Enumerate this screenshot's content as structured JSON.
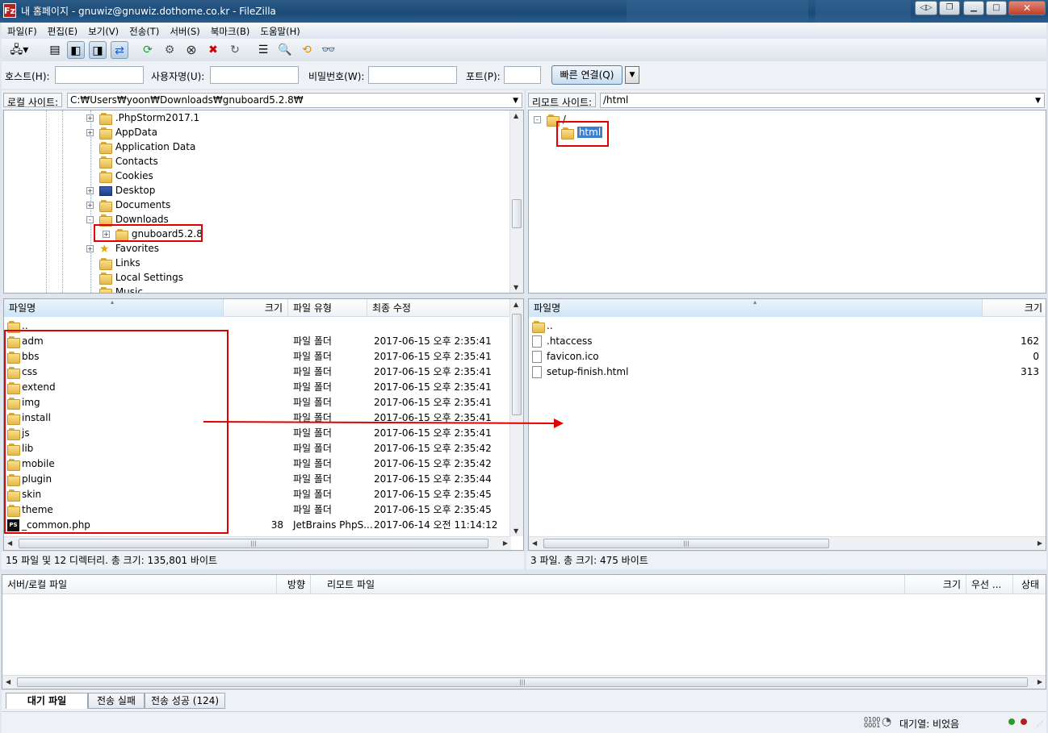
{
  "window": {
    "title": "내 홈페이지 - gnuwiz@gnuwiz.dothome.co.kr - FileZilla",
    "icon": "Fz"
  },
  "menu": [
    "파일(F)",
    "편집(E)",
    "보기(V)",
    "전송(T)",
    "서버(S)",
    "북마크(B)",
    "도움말(H)"
  ],
  "quick": {
    "host_label": "호스트(H):",
    "user_label": "사용자명(U):",
    "pass_label": "비밀번호(W):",
    "port_label": "포트(P):",
    "connect": "빠른 연결(Q)",
    "host": "",
    "user": "",
    "pass": "",
    "port": ""
  },
  "local": {
    "site_label": "로컬 사이트:",
    "path": "C:₩Users₩yoon₩Downloads₩gnuboard5.2.8₩",
    "tree": [
      {
        "name": ".PhpStorm2017.1",
        "type": "folder",
        "exp": "+"
      },
      {
        "name": "AppData",
        "type": "folder",
        "exp": "+"
      },
      {
        "name": "Application Data",
        "type": "folder",
        "exp": ""
      },
      {
        "name": "Contacts",
        "type": "folder",
        "exp": ""
      },
      {
        "name": "Cookies",
        "type": "folder",
        "exp": ""
      },
      {
        "name": "Desktop",
        "type": "desktop",
        "exp": "+"
      },
      {
        "name": "Documents",
        "type": "folder",
        "exp": "+"
      },
      {
        "name": "Downloads",
        "type": "folder",
        "exp": "-"
      },
      {
        "name": "gnuboard5.2.8",
        "type": "folder",
        "exp": "+",
        "child": true
      },
      {
        "name": "Favorites",
        "type": "star",
        "exp": "+"
      },
      {
        "name": "Links",
        "type": "folder",
        "exp": ""
      },
      {
        "name": "Local Settings",
        "type": "folder",
        "exp": ""
      },
      {
        "name": "Music",
        "type": "folder",
        "exp": ""
      }
    ],
    "columns": [
      "파일명",
      "크기",
      "파일 유형",
      "최종 수정"
    ],
    "files": [
      {
        "name": "..",
        "size": "",
        "type": "",
        "modified": "",
        "icon": "folder"
      },
      {
        "name": "adm",
        "size": "",
        "type": "파일 폴더",
        "modified": "2017-06-15 오후 2:35:41",
        "icon": "folder"
      },
      {
        "name": "bbs",
        "size": "",
        "type": "파일 폴더",
        "modified": "2017-06-15 오후 2:35:41",
        "icon": "folder"
      },
      {
        "name": "css",
        "size": "",
        "type": "파일 폴더",
        "modified": "2017-06-15 오후 2:35:41",
        "icon": "folder"
      },
      {
        "name": "extend",
        "size": "",
        "type": "파일 폴더",
        "modified": "2017-06-15 오후 2:35:41",
        "icon": "folder"
      },
      {
        "name": "img",
        "size": "",
        "type": "파일 폴더",
        "modified": "2017-06-15 오후 2:35:41",
        "icon": "folder"
      },
      {
        "name": "install",
        "size": "",
        "type": "파일 폴더",
        "modified": "2017-06-15 오후 2:35:41",
        "icon": "folder"
      },
      {
        "name": "js",
        "size": "",
        "type": "파일 폴더",
        "modified": "2017-06-15 오후 2:35:41",
        "icon": "folder"
      },
      {
        "name": "lib",
        "size": "",
        "type": "파일 폴더",
        "modified": "2017-06-15 오후 2:35:42",
        "icon": "folder"
      },
      {
        "name": "mobile",
        "size": "",
        "type": "파일 폴더",
        "modified": "2017-06-15 오후 2:35:42",
        "icon": "folder"
      },
      {
        "name": "plugin",
        "size": "",
        "type": "파일 폴더",
        "modified": "2017-06-15 오후 2:35:44",
        "icon": "folder"
      },
      {
        "name": "skin",
        "size": "",
        "type": "파일 폴더",
        "modified": "2017-06-15 오후 2:35:45",
        "icon": "folder"
      },
      {
        "name": "theme",
        "size": "",
        "type": "파일 폴더",
        "modified": "2017-06-15 오후 2:35:45",
        "icon": "folder"
      },
      {
        "name": "_common.php",
        "size": "38",
        "type": "JetBrains PhpS...",
        "modified": "2017-06-14 오전 11:14:12",
        "icon": "php"
      }
    ],
    "status": "15 파일 및 12 디렉터리. 총 크기: 135,801 바이트"
  },
  "remote": {
    "site_label": "리모트 사이트:",
    "path": "/html",
    "tree": [
      {
        "name": "/",
        "exp": "-"
      },
      {
        "name": "html",
        "exp": "",
        "selected": true
      }
    ],
    "columns": [
      "파일명",
      "크기"
    ],
    "files": [
      {
        "name": "..",
        "size": "",
        "icon": "folder"
      },
      {
        "name": ".htaccess",
        "size": "162",
        "icon": "doc"
      },
      {
        "name": "favicon.ico",
        "size": "0",
        "icon": "doc"
      },
      {
        "name": "setup-finish.html",
        "size": "313",
        "icon": "doc"
      }
    ],
    "status": "3 파일. 총 크기: 475 바이트"
  },
  "queue": {
    "columns": [
      "서버/로컬 파일",
      "방향",
      "리모트 파일",
      "크기",
      "우선 ...",
      "상태"
    ],
    "tabs": [
      "대기 파일",
      "전송 실패",
      "전송 성공 (124)"
    ],
    "status": "대기열: 비었음"
  },
  "colors": {
    "highlight": "#e50000"
  }
}
